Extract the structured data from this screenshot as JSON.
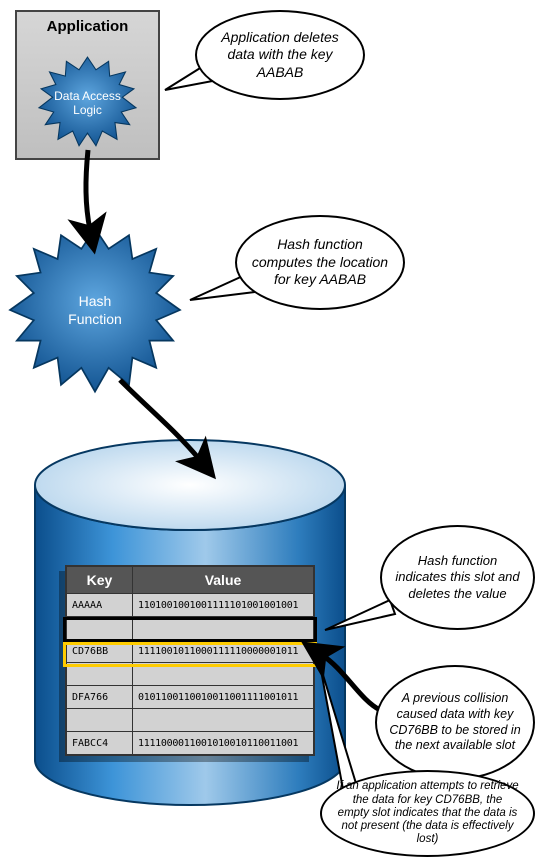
{
  "application": {
    "title": "Application",
    "data_access_logic_label_l1": "Data Access",
    "data_access_logic_label_l2": "Logic"
  },
  "hash_function": {
    "label_l1": "Hash",
    "label_l2": "Function"
  },
  "callouts": {
    "c1": "Application deletes data with the key AABAB",
    "c2": "Hash function computes the location for key AABAB",
    "c3": "Hash function indicates this slot and deletes the value",
    "c4": "A previous collision caused data with key CD76BB to be stored in the next available slot",
    "c5": "If an application attempts to retrieve the data for key CD76BB, the empty slot indicates that the data is not present (the data is effectively lost)"
  },
  "table": {
    "headers": {
      "key": "Key",
      "value": "Value"
    },
    "rows": [
      {
        "key": "AAAAA",
        "value": "1101001001001111101001001001"
      },
      {
        "key": "",
        "value": ""
      },
      {
        "key": "CD76BB",
        "value": "1111001011000111110000001011"
      },
      {
        "key": "",
        "value": ""
      },
      {
        "key": "DFA766",
        "value": "0101100110010011001111001011"
      },
      {
        "key": "",
        "value": ""
      },
      {
        "key": "FABCC4",
        "value": "1111000011001010010110011001"
      }
    ]
  },
  "colors": {
    "burst_fill": "#1f6fb8",
    "burst_stroke": "#0a3e70",
    "cylinder_side": "#3a8ed0",
    "cylinder_top": "#eaf2f9",
    "highlight_yellow": "#ffcc00"
  }
}
